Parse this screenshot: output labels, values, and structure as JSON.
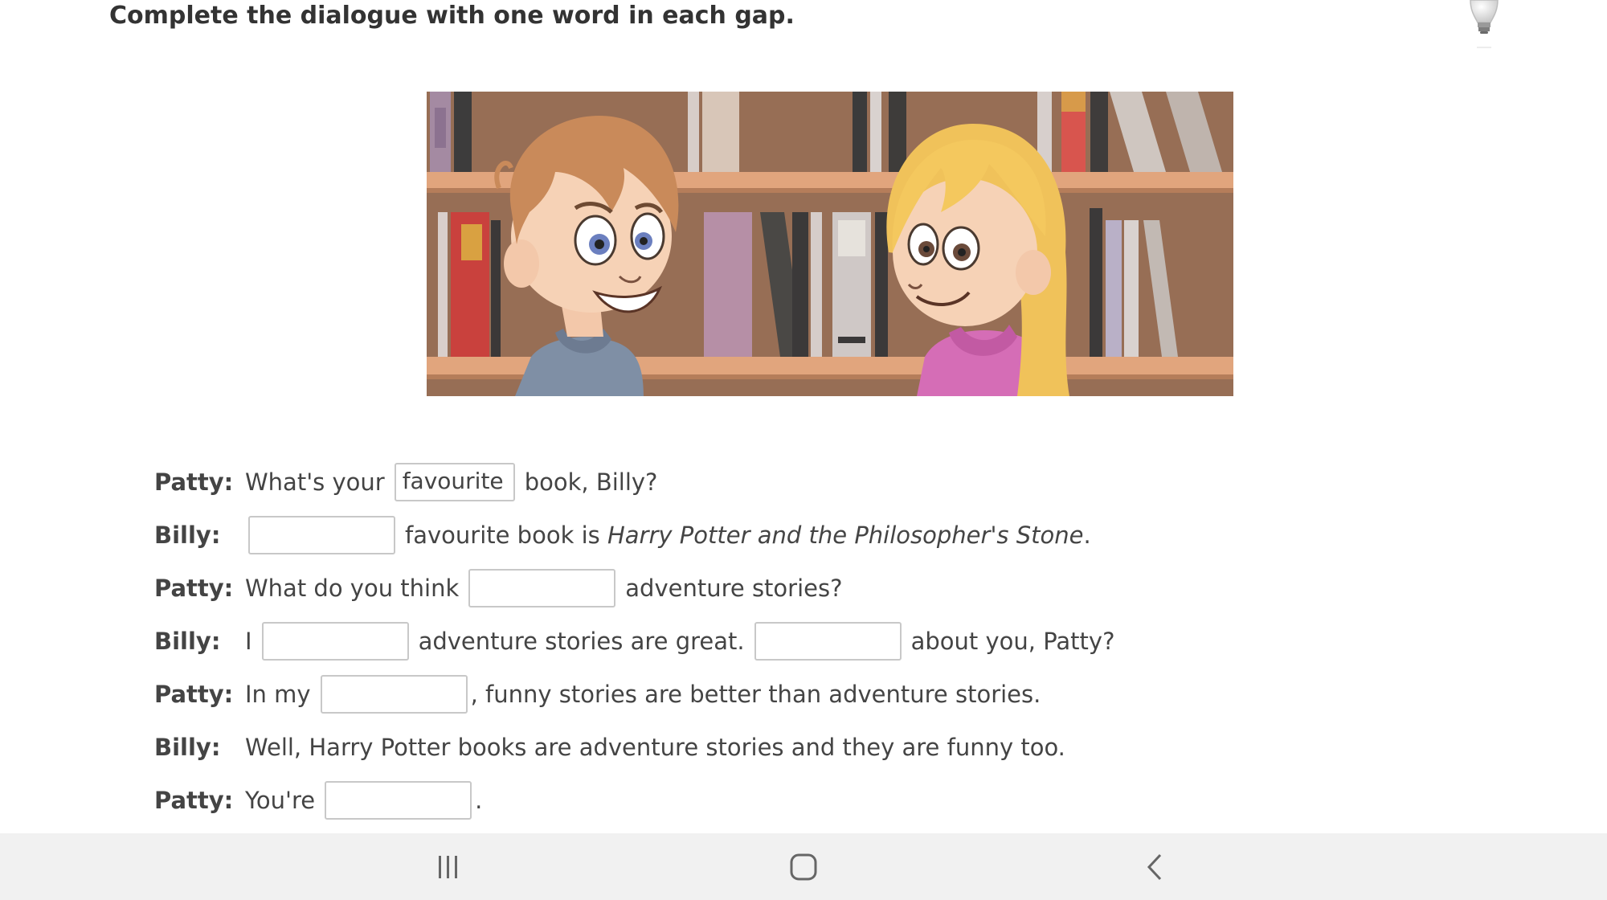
{
  "instruction": "Complete the dialogue with one word in each gap.",
  "icons": {
    "hint": "lightbulb-icon",
    "recents": "recent-apps-icon",
    "home": "home-icon",
    "back": "back-icon"
  },
  "dialogue": [
    {
      "speaker": "Patty:",
      "before": "What's your",
      "gap1": "favourite",
      "after": "book, Billy?"
    },
    {
      "speaker": "Billy:",
      "gap1": "",
      "after": "favourite book is",
      "title": "Harry Potter and the Philosopher's Stone",
      "end": "."
    },
    {
      "speaker": "Patty:",
      "before": "What do you think",
      "gap1": "",
      "after": "adventure stories?"
    },
    {
      "speaker": "Billy:",
      "before": "I",
      "gap1": "",
      "middle": "adventure stories are great.",
      "gap2": "",
      "after": "about you, Patty?"
    },
    {
      "speaker": "Patty:",
      "before": "In my",
      "gap1": "",
      "after": ", funny stories are better than adventure stories."
    },
    {
      "speaker": "Billy:",
      "before": "Well, Harry Potter books are adventure stories and they are funny too."
    },
    {
      "speaker": "Patty:",
      "before": "You're",
      "gap1": "",
      "after": "."
    }
  ],
  "colors": {
    "text": "#444444",
    "gap_border": "#c8c8c8",
    "nav_bar": "#f1f1f1"
  }
}
